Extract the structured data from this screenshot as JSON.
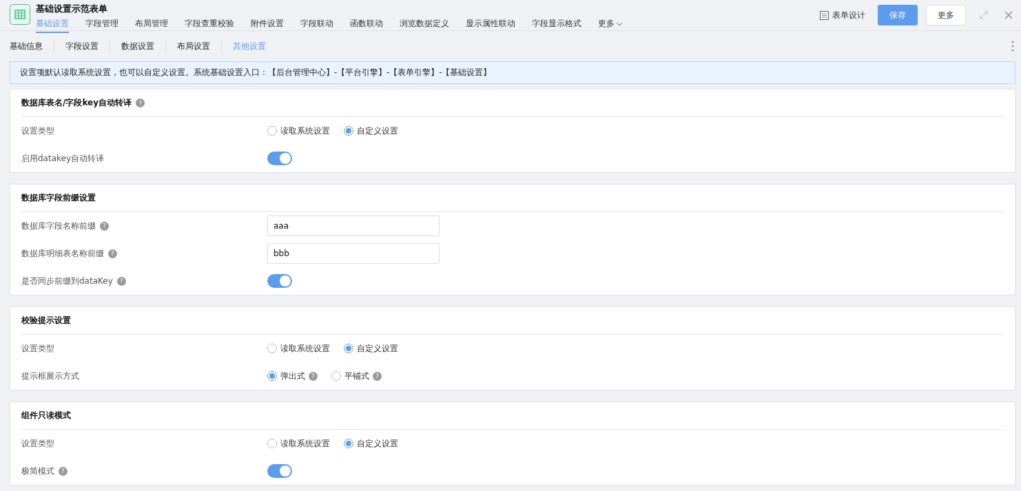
{
  "header": {
    "title": "基础设置示范表单",
    "tabs": [
      {
        "label": "基础设置",
        "selected": true
      },
      {
        "label": "字段管理",
        "selected": false
      },
      {
        "label": "布局管理",
        "selected": false
      },
      {
        "label": "字段查重校验",
        "selected": false
      },
      {
        "label": "附件设置",
        "selected": false
      },
      {
        "label": "字段联动",
        "selected": false
      },
      {
        "label": "函数联动",
        "selected": false
      },
      {
        "label": "浏览数据定义",
        "selected": false
      },
      {
        "label": "显示属性联动",
        "selected": false
      },
      {
        "label": "字段显示格式",
        "selected": false
      }
    ],
    "more_tab": "更多",
    "design": "表单设计",
    "save": "保存",
    "more": "更多"
  },
  "subtabs": [
    {
      "label": "基础信息",
      "selected": false
    },
    {
      "label": "字段设置",
      "selected": false
    },
    {
      "label": "数据设置",
      "selected": false
    },
    {
      "label": "布局设置",
      "selected": false
    },
    {
      "label": "其他设置",
      "selected": true
    }
  ],
  "notice": "设置项默认读取系统设置，也可以自定义设置。系统基础设置入口：【后台管理中心】-【平台引擎】-【表单引擎】-【基础设置】",
  "sections": [
    {
      "title": "数据库表名/字段key自动转译",
      "help": "?",
      "rows": [
        {
          "kind": "radio",
          "label": "设置类型",
          "options": [
            {
              "label": "读取系统设置",
              "selected": false
            },
            {
              "label": "自定义设置",
              "selected": true
            }
          ]
        },
        {
          "kind": "switch",
          "label": "启用datakey自动转译",
          "on": true
        }
      ]
    },
    {
      "title": "数据库字段前缀设置",
      "rows": [
        {
          "kind": "input",
          "label": "数据库字段名称前缀",
          "help": "?",
          "value": "aaa"
        },
        {
          "kind": "input",
          "label": "数据库明细表名称前缀",
          "help": "?",
          "value": "bbb"
        },
        {
          "kind": "switch",
          "label": "是否同步前缀到dataKey",
          "help": "?",
          "on": true
        }
      ]
    },
    {
      "title": "校验提示设置",
      "rows": [
        {
          "kind": "radio",
          "label": "设置类型",
          "options": [
            {
              "label": "读取系统设置",
              "selected": false
            },
            {
              "label": "自定义设置",
              "selected": true
            }
          ]
        },
        {
          "kind": "radio",
          "label": "提示框展示方式",
          "options": [
            {
              "label": "弹出式",
              "selected": true,
              "help": "?"
            },
            {
              "label": "平铺式",
              "selected": false,
              "help": "?"
            }
          ]
        }
      ]
    },
    {
      "title": "组件只读模式",
      "rows": [
        {
          "kind": "radio",
          "label": "设置类型",
          "options": [
            {
              "label": "读取系统设置",
              "selected": false
            },
            {
              "label": "自定义设置",
              "selected": true
            }
          ]
        },
        {
          "kind": "switch",
          "label": "极简模式",
          "help": "?",
          "on": true
        }
      ]
    }
  ]
}
